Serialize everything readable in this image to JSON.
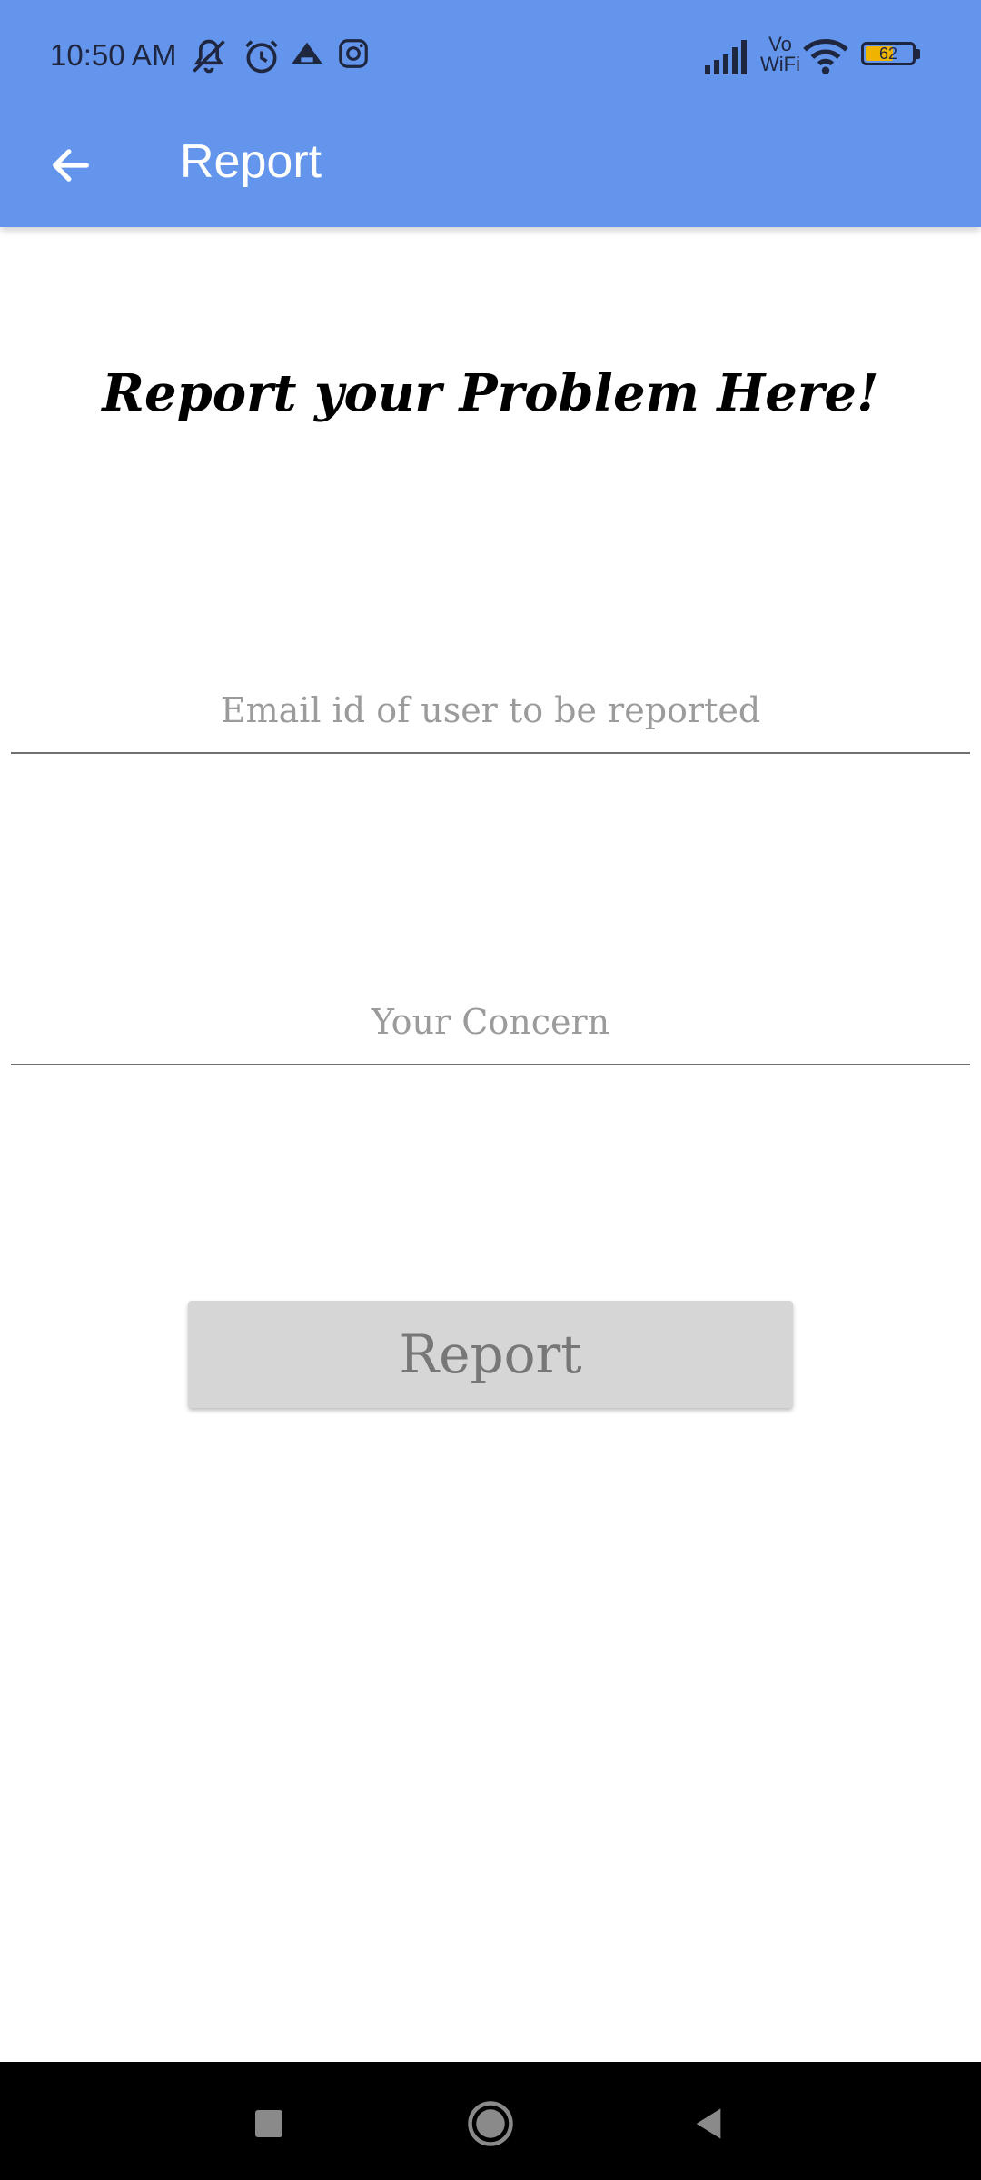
{
  "status_bar": {
    "time": "10:50 AM",
    "network": "Vo WiFi",
    "battery": "62",
    "icons": [
      "mute-icon",
      "alarm-icon",
      "vpn-icon",
      "instagram-icon",
      "signal-icon",
      "vowifi-icon",
      "wifi-icon",
      "battery-icon"
    ]
  },
  "toolbar": {
    "title": "Report",
    "back_icon": "arrow-left-icon"
  },
  "main": {
    "heading": "Report your Problem Here!",
    "email_field": {
      "placeholder": "Email id of user to be reported",
      "value": ""
    },
    "concern_field": {
      "placeholder": "Your Concern",
      "value": ""
    },
    "report_button": "Report"
  },
  "nav_bar": {
    "buttons": [
      "recents-icon",
      "home-icon",
      "back-icon"
    ]
  },
  "colors": {
    "app_bar": "#6495ed",
    "button_bg": "#d6d6d6",
    "button_text": "#777777",
    "placeholder": "#9b9b9b"
  }
}
